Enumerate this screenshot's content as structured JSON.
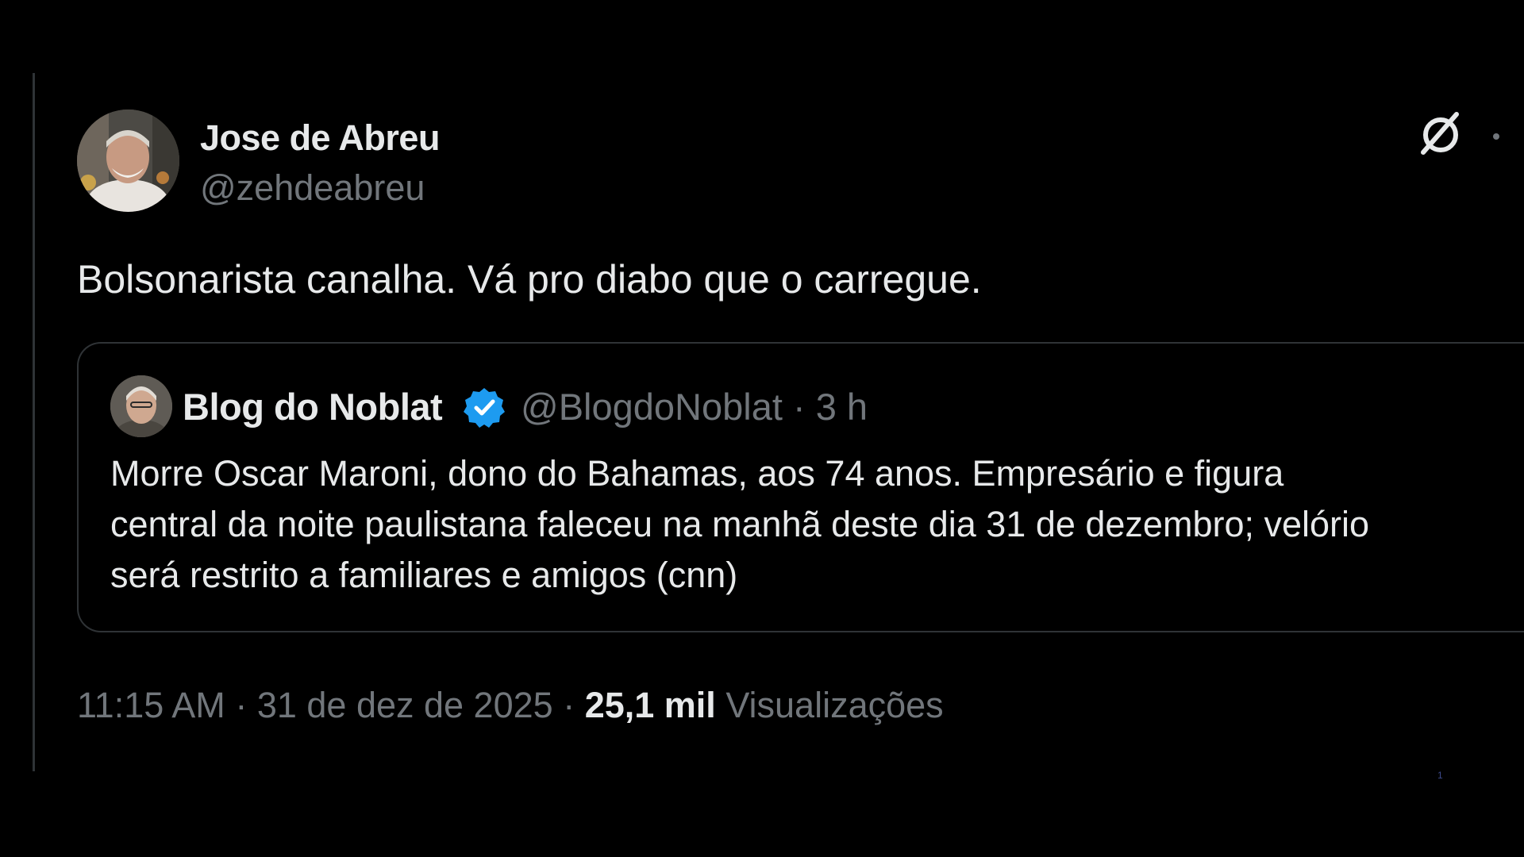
{
  "tweet": {
    "author_name": "Jose de Abreu",
    "author_handle": "@zehdeabreu",
    "text": "Bolsonarista canalha. Vá pro diabo que o carregue.",
    "time": "11:15 AM",
    "separator": "·",
    "date": "31 de dez de 2025",
    "views_count": "25,1 mil",
    "views_label": "Visualizações"
  },
  "quoted_tweet": {
    "author_name": "Blog do Noblat",
    "author_handle": "@BlogdoNoblat",
    "age": "3 h",
    "separator": "·",
    "verified": true,
    "text_lines": [
      "Morre Oscar Maroni, dono do Bahamas, aos 74 anos. Empresário e figura",
      "central da noite paulistana faleceu na manhã deste dia 31 de dezembro; velório",
      "será restrito a familiares e amigos (cnn)"
    ]
  },
  "icons": {
    "grok": "grok-icon",
    "more": "more-icon",
    "verified": "verified-badge-icon"
  },
  "colors": {
    "background": "#000000",
    "primary_text": "#e7e9ea",
    "secondary_text": "#71767b",
    "border": "#2f3336",
    "verified_blue": "#1d9bf0"
  },
  "page_number": "1"
}
